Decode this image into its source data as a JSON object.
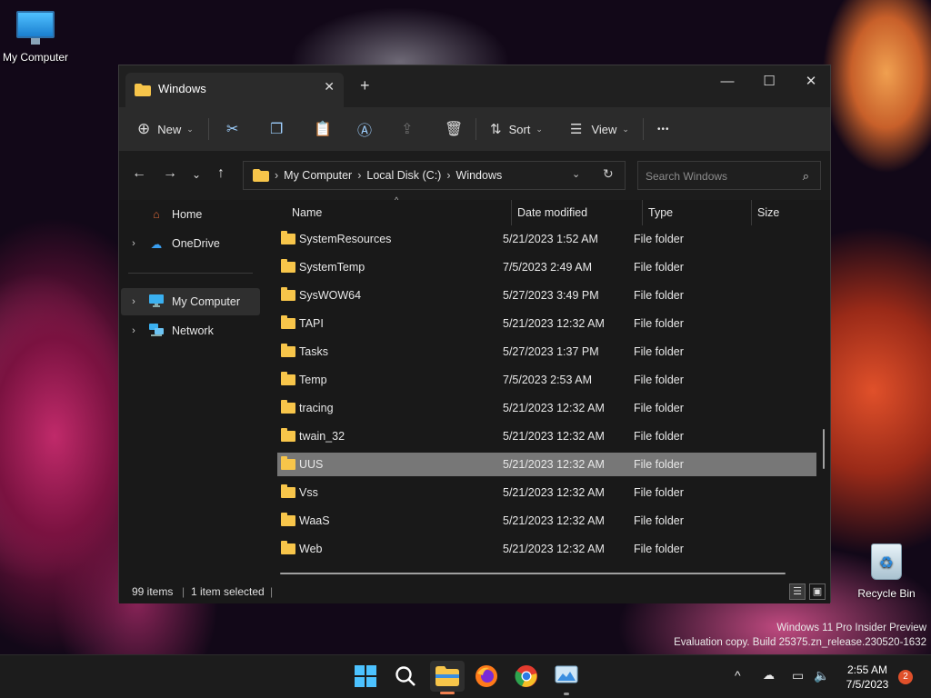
{
  "desktop": {
    "my_computer_label": "My Computer",
    "recycle_bin_label": "Recycle Bin",
    "watermark_line1": "Windows 11 Pro Insider Preview",
    "watermark_line2": "Evaluation copy. Build 25375.zn_release.230520-1632"
  },
  "window": {
    "tab_title": "Windows",
    "new_tab_glyph": "+",
    "close_tab_glyph": "✕",
    "minimize_glyph": "—",
    "maximize_glyph": "☐",
    "close_glyph": "✕"
  },
  "toolbar": {
    "new_label": "New",
    "sort_label": "Sort",
    "view_label": "View",
    "more_glyph": "•••"
  },
  "address": {
    "crumbs": [
      "My Computer",
      "Local Disk (C:)",
      "Windows"
    ],
    "search_placeholder": "Search Windows"
  },
  "sidebar": {
    "items": [
      {
        "label": "Home",
        "icon": "home-icon"
      },
      {
        "label": "OneDrive",
        "icon": "cloud-icon"
      },
      {
        "label": "My Computer",
        "icon": "monitor-icon"
      },
      {
        "label": "Network",
        "icon": "network-icon"
      }
    ]
  },
  "columns": {
    "name": "Name",
    "date": "Date modified",
    "type": "Type",
    "size": "Size"
  },
  "files": [
    {
      "name": "SystemResources",
      "date": "5/21/2023 1:52 AM",
      "type": "File folder"
    },
    {
      "name": "SystemTemp",
      "date": "7/5/2023 2:49 AM",
      "type": "File folder"
    },
    {
      "name": "SysWOW64",
      "date": "5/27/2023 3:49 PM",
      "type": "File folder"
    },
    {
      "name": "TAPI",
      "date": "5/21/2023 12:32 AM",
      "type": "File folder"
    },
    {
      "name": "Tasks",
      "date": "5/27/2023 1:37 PM",
      "type": "File folder"
    },
    {
      "name": "Temp",
      "date": "7/5/2023 2:53 AM",
      "type": "File folder"
    },
    {
      "name": "tracing",
      "date": "5/21/2023 12:32 AM",
      "type": "File folder"
    },
    {
      "name": "twain_32",
      "date": "5/21/2023 12:32 AM",
      "type": "File folder"
    },
    {
      "name": "UUS",
      "date": "5/21/2023 12:32 AM",
      "type": "File folder",
      "selected": true
    },
    {
      "name": "Vss",
      "date": "5/21/2023 12:32 AM",
      "type": "File folder"
    },
    {
      "name": "WaaS",
      "date": "5/21/2023 12:32 AM",
      "type": "File folder"
    },
    {
      "name": "Web",
      "date": "5/21/2023 12:32 AM",
      "type": "File folder"
    }
  ],
  "status": {
    "item_count": "99 items",
    "selected_count": "1 item selected"
  },
  "taskbar": {
    "time": "2:55 AM",
    "date": "7/5/2023",
    "notification_count": "2"
  },
  "colors": {
    "accent": "#4cc2ff",
    "folder": "#f7c54a",
    "selected_row": "#777777"
  }
}
